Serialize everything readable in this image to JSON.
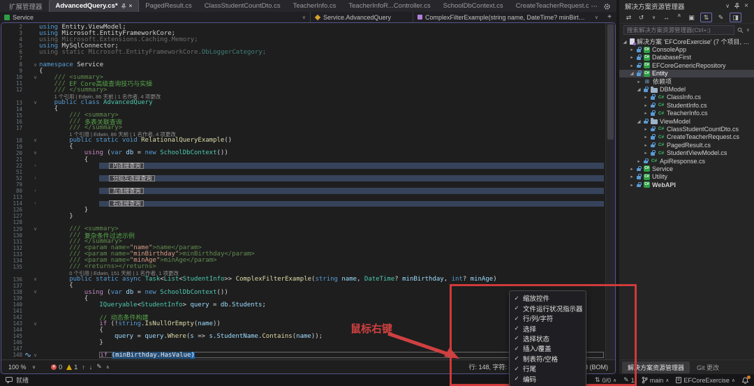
{
  "icons": {
    "chevron_down": "∨",
    "chevron_up": "∧",
    "close": "×",
    "more": "⋯",
    "plus": "+",
    "check": "✓",
    "fold_open": "∨",
    "fold_closed": "›",
    "tree_open": "◢",
    "tree_closed": "▸",
    "arrow_up": "↑",
    "arrow_down": "↓",
    "updown": "⇅",
    "pencil": "✎",
    "error_x": "×",
    "tb_sync": "⇄",
    "tb_history": "↺",
    "tb_switch": "↔",
    "tb_collapse": "«",
    "tb_files": "▣",
    "tb_track": "⇅",
    "tb_edit": "✎",
    "tb_preview": "◨",
    "dependencies": "⊞"
  },
  "colors": {
    "accent_red": "#cf3a3a",
    "selection_blue": "#264f78",
    "error_red": "#d9534f",
    "warning_yellow": "#d9a406"
  },
  "tab_bar": {
    "tabs": [
      {
        "label": "扩展管理器",
        "active": false
      },
      {
        "label": "AdvancedQuery.cs*",
        "active": true
      },
      {
        "label": "PagedResult.cs",
        "active": false
      },
      {
        "label": "ClassStudentCountDto.cs",
        "active": false
      },
      {
        "label": "TeacherInfo.cs",
        "active": false
      },
      {
        "label": "TeacherInfoR...Controller.cs",
        "active": false
      },
      {
        "label": "SchoolDbContext.cs",
        "active": false
      },
      {
        "label": "CreateTeacherRequest.cs",
        "active": false
      }
    ]
  },
  "breadcrumb": {
    "segments": [
      {
        "label": "Service"
      },
      {
        "label": "Service.AdvancedQuery"
      },
      {
        "label": "ComplexFilterExample(string name, DateTime? minBirthday, int? minAge)"
      }
    ]
  },
  "editor": {
    "status": {
      "zoom": "100 %",
      "errors": "0",
      "warnings": "1",
      "line_info": "行: 148, 字符: 42",
      "encoding": "UTF-8 (BOM)"
    },
    "lines": [
      {
        "n": "2",
        "i": 0,
        "f": "",
        "t": "c",
        "k": [
          [
            "kw",
            "using"
          ],
          [
            "pl",
            " Entity.ViewModel;"
          ]
        ]
      },
      {
        "n": "3",
        "i": 0,
        "f": "",
        "t": "c",
        "k": [
          [
            "kw",
            "using"
          ],
          [
            "pl",
            " Microsoft.EntityFrameworkCore;"
          ]
        ]
      },
      {
        "n": "4",
        "i": 0,
        "f": "",
        "t": "c",
        "k": [
          [
            "dm",
            "using Microsoft.Extensions.Caching.Memory;"
          ]
        ]
      },
      {
        "n": "5",
        "i": 0,
        "f": "",
        "t": "c",
        "k": [
          [
            "kw",
            "using"
          ],
          [
            "pl",
            " MySqlConnector;"
          ]
        ]
      },
      {
        "n": "6",
        "i": 0,
        "f": "",
        "t": "c",
        "k": [
          [
            "dm",
            "using static Microsoft.EntityFrameworkCore."
          ],
          [
            "tyd",
            "DbLoggerCategory"
          ],
          [
            "dm",
            ";"
          ]
        ]
      },
      {
        "n": "7",
        "i": 0,
        "f": "",
        "t": "c",
        "k": []
      },
      {
        "n": "8",
        "i": 0,
        "f": "o",
        "t": "c",
        "k": [
          [
            "kw",
            "namespace"
          ],
          [
            "pl",
            " Service"
          ]
        ]
      },
      {
        "n": "9",
        "i": 0,
        "f": "",
        "t": "c",
        "k": [
          [
            "pl",
            "{"
          ]
        ]
      },
      {
        "n": "10",
        "i": 4,
        "f": "o",
        "t": "c",
        "k": [
          [
            "dc",
            "/// <summary>"
          ]
        ]
      },
      {
        "n": "11",
        "i": 4,
        "f": "",
        "t": "c",
        "k": [
          [
            "dc",
            "/// "
          ],
          [
            "cm",
            "EF Core高级查询技巧与实操"
          ]
        ]
      },
      {
        "n": "12",
        "i": 4,
        "f": "",
        "t": "c",
        "k": [
          [
            "dc",
            "/// </summary>"
          ]
        ]
      },
      {
        "n": "",
        "i": 4,
        "f": "",
        "t": "l",
        "s": "1 个引用 | Edwin, 86 天前 | 1 名作者, 4 项更改"
      },
      {
        "n": "13",
        "i": 4,
        "f": "o",
        "t": "c",
        "k": [
          [
            "kw",
            "public class "
          ],
          [
            "ty",
            "AdvancedQuery"
          ]
        ]
      },
      {
        "n": "14",
        "i": 4,
        "f": "",
        "t": "c",
        "k": [
          [
            "pl",
            "{"
          ]
        ]
      },
      {
        "n": "15",
        "i": 8,
        "f": "",
        "t": "c",
        "k": [
          [
            "dc",
            "/// <summary>"
          ]
        ]
      },
      {
        "n": "16",
        "i": 8,
        "f": "",
        "t": "c",
        "k": [
          [
            "dc",
            "/// "
          ],
          [
            "cm",
            "多表关联查询"
          ]
        ]
      },
      {
        "n": "17",
        "i": 8,
        "f": "",
        "t": "c",
        "k": [
          [
            "dc",
            "/// </summary>"
          ]
        ]
      },
      {
        "n": "",
        "i": 8,
        "f": "",
        "t": "l",
        "s": "1 个引用 | Edwin, 86 天前 | 1 名作者, 4 项更改"
      },
      {
        "n": "18",
        "i": 8,
        "f": "o",
        "t": "c",
        "k": [
          [
            "kw",
            "public static void "
          ],
          [
            "me",
            "RelationalQueryExample"
          ],
          [
            "pl",
            "()"
          ]
        ]
      },
      {
        "n": "19",
        "i": 8,
        "f": "",
        "t": "c",
        "k": [
          [
            "pl",
            "{"
          ]
        ]
      },
      {
        "n": "20",
        "i": 12,
        "f": "o",
        "t": "c",
        "k": [
          [
            "ct",
            "using"
          ],
          [
            "pl",
            " ("
          ],
          [
            "kw",
            "var"
          ],
          [
            "va",
            " db"
          ],
          [
            "pl",
            " = "
          ],
          [
            "kw",
            "new"
          ],
          [
            "ty",
            " SchoolDbContext"
          ],
          [
            "pl",
            "())"
          ]
        ]
      },
      {
        "n": "21",
        "i": 12,
        "f": "",
        "t": "c",
        "k": [
          [
            "pl",
            "{"
          ]
        ]
      },
      {
        "n": "22",
        "i": 16,
        "f": "c",
        "t": "x",
        "s": "内连接查询"
      },
      {
        "n": "51",
        "i": 0,
        "f": "",
        "t": "c",
        "k": []
      },
      {
        "n": "52",
        "i": 16,
        "f": "c",
        "t": "x",
        "s": "分组左连接查询"
      },
      {
        "n": "79",
        "i": 0,
        "f": "",
        "t": "c",
        "k": []
      },
      {
        "n": "80",
        "i": 16,
        "f": "c",
        "t": "x",
        "s": "左连接查询"
      },
      {
        "n": "113",
        "i": 0,
        "f": "",
        "t": "c",
        "k": []
      },
      {
        "n": "114",
        "i": 16,
        "f": "c",
        "t": "x",
        "s": "右连接查询"
      },
      {
        "n": "126",
        "i": 12,
        "f": "",
        "t": "c",
        "k": [
          [
            "pl",
            "}"
          ]
        ]
      },
      {
        "n": "127",
        "i": 8,
        "f": "",
        "t": "c",
        "k": [
          [
            "pl",
            "}"
          ]
        ]
      },
      {
        "n": "128",
        "i": 0,
        "f": "",
        "t": "c",
        "k": []
      },
      {
        "n": "129",
        "i": 8,
        "f": "o",
        "t": "c",
        "k": [
          [
            "dc",
            "/// <summary>"
          ]
        ]
      },
      {
        "n": "130",
        "i": 8,
        "f": "",
        "t": "c",
        "k": [
          [
            "dc",
            "/// "
          ],
          [
            "cm",
            "复杂条件过滤示例"
          ]
        ]
      },
      {
        "n": "131",
        "i": 8,
        "f": "",
        "t": "c",
        "k": [
          [
            "dc",
            "/// </summary>"
          ]
        ]
      },
      {
        "n": "132",
        "i": 8,
        "f": "",
        "t": "c",
        "k": [
          [
            "dc",
            "/// <param name="
          ],
          [
            "st",
            "\"name\""
          ],
          [
            "dc",
            ">name</param>"
          ]
        ]
      },
      {
        "n": "133",
        "i": 8,
        "f": "",
        "t": "c",
        "k": [
          [
            "dc",
            "/// <param name="
          ],
          [
            "st",
            "\"minBirthday\""
          ],
          [
            "dc",
            ">minBirthday</param>"
          ]
        ]
      },
      {
        "n": "134",
        "i": 8,
        "f": "",
        "t": "c",
        "k": [
          [
            "dc",
            "/// <param name="
          ],
          [
            "st",
            "\"minAge\""
          ],
          [
            "dc",
            ">minAge</param>"
          ]
        ]
      },
      {
        "n": "135",
        "i": 8,
        "f": "",
        "t": "c",
        "k": [
          [
            "dc",
            "/// <returns></returns>"
          ]
        ]
      },
      {
        "n": "",
        "i": 8,
        "f": "",
        "t": "l",
        "s": "0 个引用 | Edwin, 151 天前 | 1 名作者, 1 项更改"
      },
      {
        "n": "136",
        "i": 8,
        "f": "o",
        "t": "c",
        "k": [
          [
            "kw",
            "public static async "
          ],
          [
            "ty",
            "Task"
          ],
          [
            "pl",
            "<"
          ],
          [
            "ty",
            "List"
          ],
          [
            "pl",
            "<"
          ],
          [
            "ty",
            "StudentInfo"
          ],
          [
            "pl",
            ">> "
          ],
          [
            "me",
            "ComplexFilterExample"
          ],
          [
            "pl",
            "("
          ],
          [
            "kw",
            "string"
          ],
          [
            "va",
            " name"
          ],
          [
            "pl",
            ", "
          ],
          [
            "ty",
            "DateTime"
          ],
          [
            "pl",
            "? "
          ],
          [
            "va",
            "minBirthday"
          ],
          [
            "pl",
            ", "
          ],
          [
            "kw",
            "int"
          ],
          [
            "pl",
            "? "
          ],
          [
            "va",
            "minAge"
          ],
          [
            "pl",
            ")"
          ]
        ]
      },
      {
        "n": "137",
        "i": 8,
        "f": "",
        "t": "c",
        "k": [
          [
            "pl",
            "{"
          ]
        ]
      },
      {
        "n": "138",
        "i": 12,
        "f": "o",
        "t": "c",
        "k": [
          [
            "ct",
            "using"
          ],
          [
            "pl",
            " ("
          ],
          [
            "kw",
            "var"
          ],
          [
            "va",
            " db"
          ],
          [
            "pl",
            " = "
          ],
          [
            "kw",
            "new"
          ],
          [
            "ty",
            " SchoolDbContext"
          ],
          [
            "pl",
            "())"
          ]
        ]
      },
      {
        "n": "139",
        "i": 12,
        "f": "",
        "t": "c",
        "k": [
          [
            "pl",
            "{"
          ]
        ]
      },
      {
        "n": "140",
        "i": 16,
        "f": "",
        "t": "c",
        "k": [
          [
            "ty",
            "IQueryable"
          ],
          [
            "pl",
            "<"
          ],
          [
            "ty",
            "StudentInfo"
          ],
          [
            "pl",
            "> "
          ],
          [
            "va",
            "query"
          ],
          [
            "pl",
            " = "
          ],
          [
            "va",
            "db"
          ],
          [
            "pl",
            "."
          ],
          [
            "va",
            "Students"
          ],
          [
            "pl",
            ";"
          ]
        ]
      },
      {
        "n": "141",
        "i": 0,
        "f": "",
        "t": "c",
        "k": []
      },
      {
        "n": "142",
        "i": 16,
        "f": "",
        "t": "c",
        "k": [
          [
            "cm",
            "// 动态条件构建"
          ]
        ]
      },
      {
        "n": "143",
        "i": 16,
        "f": "o",
        "t": "c",
        "k": [
          [
            "ct",
            "if"
          ],
          [
            "pl",
            " (!"
          ],
          [
            "kw",
            "string"
          ],
          [
            "pl",
            "."
          ],
          [
            "me",
            "IsNullOrEmpty"
          ],
          [
            "pl",
            "("
          ],
          [
            "va",
            "name"
          ],
          [
            "pl",
            "))"
          ]
        ]
      },
      {
        "n": "144",
        "i": 16,
        "f": "",
        "t": "c",
        "k": [
          [
            "pl",
            "{"
          ]
        ]
      },
      {
        "n": "145",
        "i": 20,
        "f": "",
        "t": "c",
        "k": [
          [
            "va",
            "query"
          ],
          [
            "pl",
            " = "
          ],
          [
            "va",
            "query"
          ],
          [
            "pl",
            "."
          ],
          [
            "me",
            "Where"
          ],
          [
            "pl",
            "("
          ],
          [
            "va",
            "s"
          ],
          [
            "pl",
            " => "
          ],
          [
            "va",
            "s"
          ],
          [
            "pl",
            "."
          ],
          [
            "va",
            "StudentName"
          ],
          [
            "pl",
            "."
          ],
          [
            "me",
            "Contains"
          ],
          [
            "pl",
            "("
          ],
          [
            "va",
            "name"
          ],
          [
            "pl",
            "));"
          ]
        ]
      },
      {
        "n": "146",
        "i": 16,
        "f": "",
        "t": "c",
        "k": [
          [
            "pl",
            "}"
          ]
        ]
      },
      {
        "n": "147",
        "i": 0,
        "f": "",
        "t": "c",
        "k": []
      },
      {
        "n": "148",
        "i": 16,
        "f": "o",
        "t": "b",
        "k": [
          [
            "ct",
            "if"
          ],
          [
            "pl",
            " "
          ],
          [
            "se",
            "(minBirthday.HasValue"
          ],
          [
            "brc",
            ")"
          ]
        ]
      }
    ]
  },
  "annotation": {
    "label": "鼠标右键"
  },
  "context_menu": {
    "items": [
      "缩放控件",
      "文件运行状况指示器",
      "行/列/字符",
      "选择",
      "选择状态",
      "插入/覆盖",
      "制表符/空格",
      "行尾",
      "编码"
    ]
  },
  "solution_explorer": {
    "title": "解决方案资源管理器",
    "search_placeholder": "搜索解决方案资源管理器(Ctrl+;)",
    "tree": [
      {
        "lv": 0,
        "ic": "sln",
        "ex": "o",
        "tx": "解决方案 'EFCoreExercise' (7 个项目, 共 7 个)"
      },
      {
        "lv": 1,
        "ic": "prj",
        "ex": "c",
        "lock": true,
        "tx": "ConsoleApp"
      },
      {
        "lv": 1,
        "ic": "prj",
        "ex": "c",
        "lock": true,
        "tx": "DatabaseFirst"
      },
      {
        "lv": 1,
        "ic": "prj",
        "ex": "c",
        "lock": true,
        "tx": "EFCoreGenericRepository"
      },
      {
        "lv": 1,
        "ic": "prj",
        "ex": "o",
        "lock": true,
        "sel": true,
        "tx": "Entity"
      },
      {
        "lv": 2,
        "ic": "dep",
        "ex": "c",
        "tx": "依赖项"
      },
      {
        "lv": 2,
        "ic": "fld",
        "ex": "o",
        "lock": true,
        "tx": "DBModel"
      },
      {
        "lv": 3,
        "ic": "cs",
        "ex": "c",
        "lock": true,
        "tx": "ClassInfo.cs"
      },
      {
        "lv": 3,
        "ic": "cs",
        "ex": "c",
        "lock": true,
        "tx": "StudentInfo.cs"
      },
      {
        "lv": 3,
        "ic": "cs",
        "ex": "c",
        "lock": true,
        "tx": "TeacherInfo.cs"
      },
      {
        "lv": 2,
        "ic": "fld",
        "ex": "o",
        "lock": true,
        "tx": "ViewModel"
      },
      {
        "lv": 3,
        "ic": "cs",
        "ex": "c",
        "lock": true,
        "tx": "ClassStudentCountDto.cs"
      },
      {
        "lv": 3,
        "ic": "cs",
        "ex": "c",
        "lock": true,
        "tx": "CreateTeacherRequest.cs"
      },
      {
        "lv": 3,
        "ic": "cs",
        "ex": "c",
        "lock": true,
        "tx": "PagedResult.cs"
      },
      {
        "lv": 3,
        "ic": "cs",
        "ex": "c",
        "lock": true,
        "tx": "StudentViewModel.cs"
      },
      {
        "lv": 2,
        "ic": "cs",
        "ex": "c",
        "lock": true,
        "tx": "ApiResponse.cs"
      },
      {
        "lv": 1,
        "ic": "prj",
        "ex": "c",
        "lock": true,
        "tx": "Service"
      },
      {
        "lv": 1,
        "ic": "prj",
        "ex": "c",
        "lock": true,
        "tx": "Utility"
      },
      {
        "lv": 1,
        "ic": "prj",
        "ex": "c",
        "lock": true,
        "bold": true,
        "tx": "WebAPI"
      }
    ]
  },
  "panel_tabs": [
    "解决方案资源管理器",
    "Git 更改"
  ],
  "status_bar": {
    "ready": "就绪",
    "sync": "0/0",
    "edits": "1",
    "branch": "main",
    "repo": "EFCoreExercise"
  }
}
